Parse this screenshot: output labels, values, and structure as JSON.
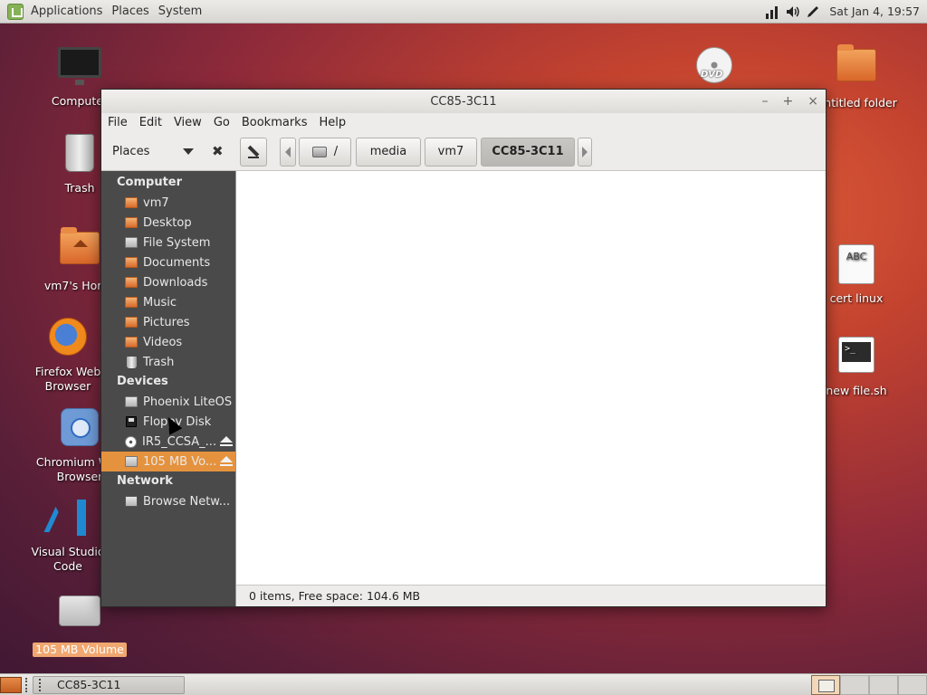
{
  "top_panel": {
    "menu": [
      "Applications",
      "Places",
      "System"
    ],
    "clock": "Sat Jan  4, 19:57",
    "tray_icons": [
      "network-icon",
      "volume-icon",
      "pencil-tool-icon"
    ]
  },
  "desktop": {
    "icons": [
      {
        "label": "Computer",
        "icon": "computer-icon"
      },
      {
        "label": "Trash",
        "icon": "trash-icon"
      },
      {
        "label": "vm7's Home",
        "icon": "home-folder-icon"
      },
      {
        "label": "Firefox Web Browser",
        "icon": "firefox-icon"
      },
      {
        "label": "Chromium Web Browser",
        "icon": "chromium-icon"
      },
      {
        "label": "Visual Studio Code",
        "icon": "vscode-icon"
      },
      {
        "label": "105 MB Volume",
        "icon": "usb-drive-icon"
      },
      {
        "label": "DVD",
        "icon": "dvd-icon"
      },
      {
        "label": "Untitled folder",
        "icon": "folder-icon"
      },
      {
        "label": "cert linux",
        "icon": "text-document-icon",
        "badge": "ABC"
      },
      {
        "label": "new file.sh",
        "icon": "shell-script-icon",
        "badge": ">_"
      }
    ]
  },
  "window": {
    "title": "CC85-3C11",
    "controls": [
      "–",
      "+",
      "×"
    ],
    "menubar": [
      "File",
      "Edit",
      "View",
      "Go",
      "Bookmarks",
      "Help"
    ],
    "sidebar_selector": "Places",
    "path": [
      "/",
      "media",
      "vm7",
      "CC85-3C11"
    ],
    "sidebar": {
      "sections": [
        {
          "heading": "Computer",
          "items": [
            {
              "label": "vm7",
              "icon": "home-folder-icon"
            },
            {
              "label": "Desktop",
              "icon": "desktop-folder-icon"
            },
            {
              "label": "File System",
              "icon": "drive-icon"
            },
            {
              "label": "Documents",
              "icon": "folder-icon"
            },
            {
              "label": "Downloads",
              "icon": "folder-icon"
            },
            {
              "label": "Music",
              "icon": "folder-icon"
            },
            {
              "label": "Pictures",
              "icon": "folder-icon"
            },
            {
              "label": "Videos",
              "icon": "folder-icon"
            },
            {
              "label": "Trash",
              "icon": "trash-icon"
            }
          ]
        },
        {
          "heading": "Devices",
          "items": [
            {
              "label": "Phoenix LiteOS",
              "icon": "drive-icon"
            },
            {
              "label": "Floppy Disk",
              "icon": "floppy-icon"
            },
            {
              "label": "IR5_CCSA_...",
              "icon": "cd-icon",
              "eject": true
            },
            {
              "label": "105 MB Vo...",
              "icon": "drive-icon",
              "eject": true,
              "selected": true
            }
          ]
        },
        {
          "heading": "Network",
          "items": [
            {
              "label": "Browse Netw...",
              "icon": "network-icon"
            }
          ]
        }
      ]
    },
    "status": "0 items, Free space: 104.6 MB"
  },
  "bottom_panel": {
    "task": "CC85-3C11"
  },
  "colors": {
    "selection": "#e5923e",
    "sidebar_bg": "#4a4a4a",
    "panel_bg": "#ecebe8"
  }
}
